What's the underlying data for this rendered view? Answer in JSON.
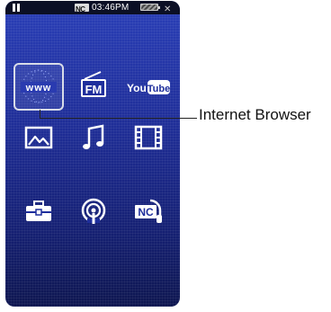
{
  "status_bar": {
    "playback_state_icon": "pause-icon",
    "source_badge": "NC",
    "time": "03:46PM",
    "battery_icon": "battery-icon",
    "volume_icon": "mute-icon"
  },
  "home_menu": {
    "items": [
      {
        "name": "Internet Browser",
        "icon": "www-icon",
        "selected": true
      },
      {
        "name": "FM Radio",
        "icon": "fm-radio-icon",
        "glyph": "FM",
        "selected": false
      },
      {
        "name": "YouTube",
        "icon": "youtube-icon",
        "glyph_you": "You",
        "glyph_tube": "Tube",
        "selected": false
      },
      {
        "name": "Photo",
        "icon": "photo-icon",
        "selected": false
      },
      {
        "name": "Music",
        "icon": "music-note-icon",
        "selected": false
      },
      {
        "name": "Video",
        "icon": "film-icon",
        "selected": false
      },
      {
        "name": "Settings",
        "icon": "toolbox-icon",
        "selected": false
      },
      {
        "name": "Podcast",
        "icon": "podcast-icon",
        "selected": false
      },
      {
        "name": "Noise Canceling",
        "icon": "noise-cancel-icon",
        "glyph": "NC",
        "selected": false
      }
    ]
  },
  "callout": {
    "label": "Internet Browser"
  },
  "colors": {
    "screen_top": "#2a3fb8",
    "screen_bottom": "#0e1650",
    "icon": "#ffffff"
  }
}
